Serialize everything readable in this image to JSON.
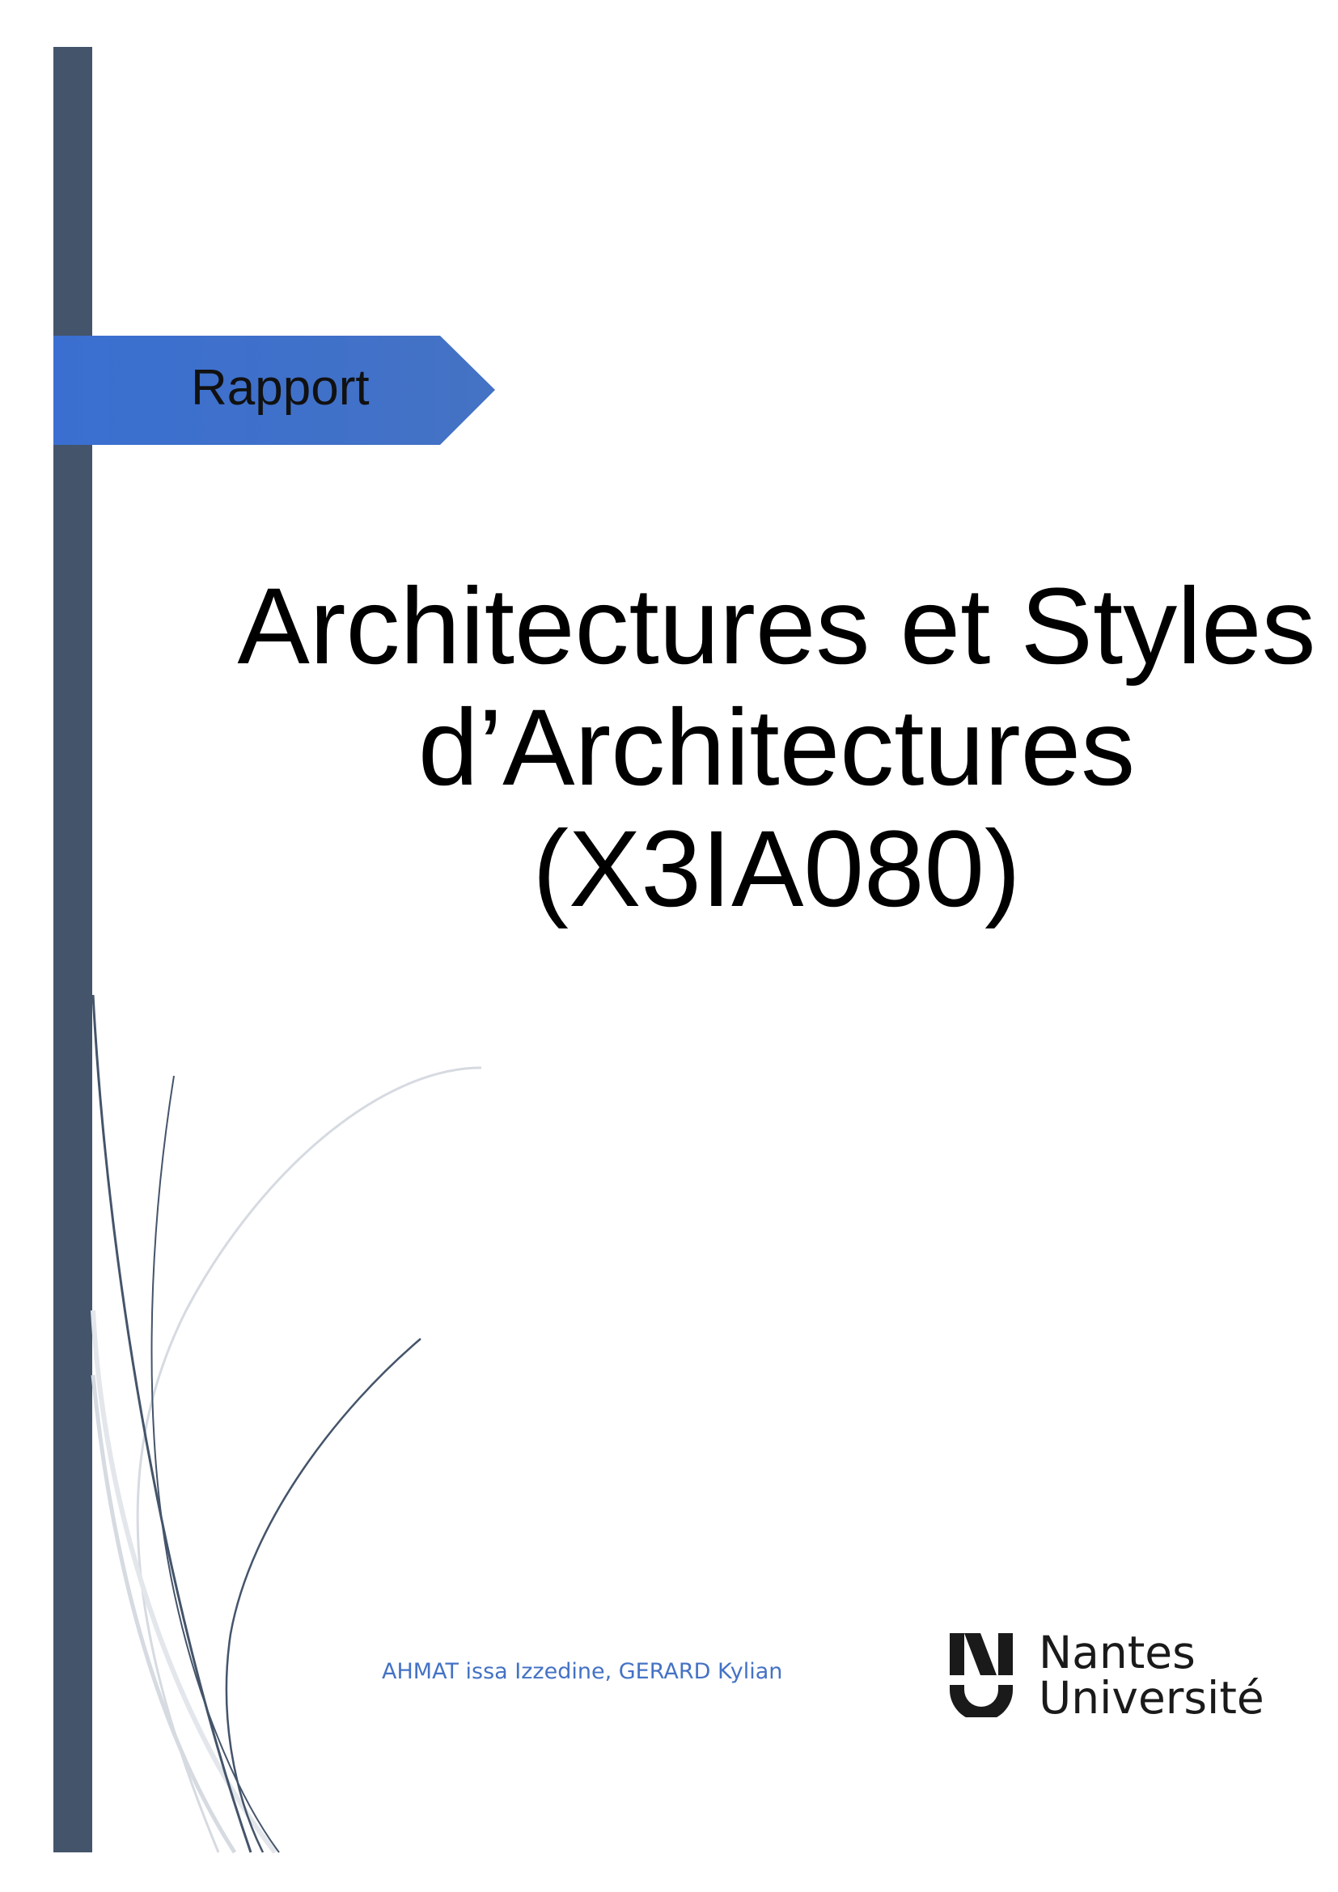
{
  "cover": {
    "ribbon_label": "Rapport",
    "title_lines": [
      "Architectures et Styles",
      "d’Architectures",
      "(X3IA080)"
    ],
    "authors": "AHMAT issa Izzedine, GERARD Kylian",
    "logo": {
      "line1": "Nantes",
      "line2": "Université"
    }
  },
  "colors": {
    "sidebar": "#44546a",
    "ribbon": "#4472c4",
    "authors_text": "#4472c4",
    "curve_dark": "#44546a",
    "curve_light": "#d0d4dc"
  }
}
